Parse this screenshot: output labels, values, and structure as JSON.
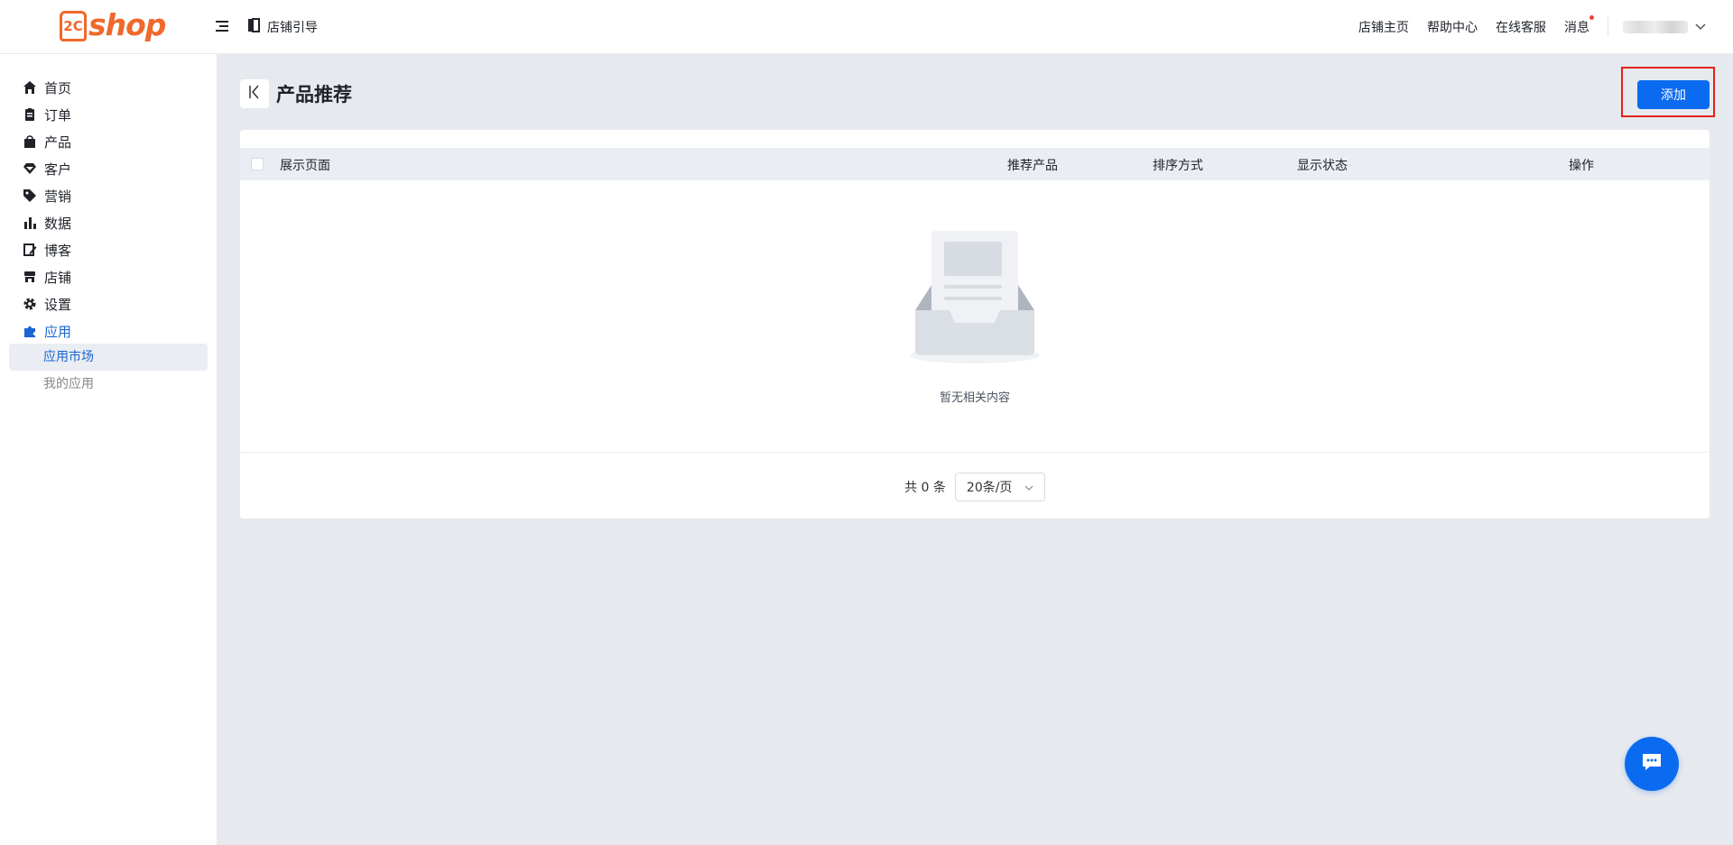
{
  "header": {
    "logo_badge": "2C",
    "logo_text": "shop",
    "guide_label": "店铺引导",
    "links": {
      "store_home": "店铺主页",
      "help_center": "帮助中心",
      "online_service": "在线客服",
      "messages": "消息"
    }
  },
  "sidebar": {
    "items": [
      {
        "label": "首页",
        "icon": "home-icon"
      },
      {
        "label": "订单",
        "icon": "order-clipboard-icon"
      },
      {
        "label": "产品",
        "icon": "shopping-bag-icon"
      },
      {
        "label": "客户",
        "icon": "diamond-icon"
      },
      {
        "label": "营销",
        "icon": "tag-icon"
      },
      {
        "label": "数据",
        "icon": "bar-chart-icon"
      },
      {
        "label": "博客",
        "icon": "edit-icon"
      },
      {
        "label": "店铺",
        "icon": "store-icon"
      },
      {
        "label": "设置",
        "icon": "gear-icon"
      },
      {
        "label": "应用",
        "icon": "puzzle-icon"
      }
    ],
    "sub_items": [
      {
        "label": "应用市场"
      },
      {
        "label": "我的应用"
      }
    ]
  },
  "page": {
    "title": "产品推荐",
    "add_button": "添加"
  },
  "table": {
    "columns": [
      "展示页面",
      "推荐产品",
      "排序方式",
      "显示状态",
      "操作"
    ],
    "empty_text": "暂无相关内容"
  },
  "pagination": {
    "total_text": "共 0 条",
    "page_size": "20条/页"
  },
  "colors": {
    "brand": "#f0682b",
    "primary": "#0b6bf0",
    "active_nav": "#1966d2",
    "highlight_frame": "#e2231a"
  }
}
